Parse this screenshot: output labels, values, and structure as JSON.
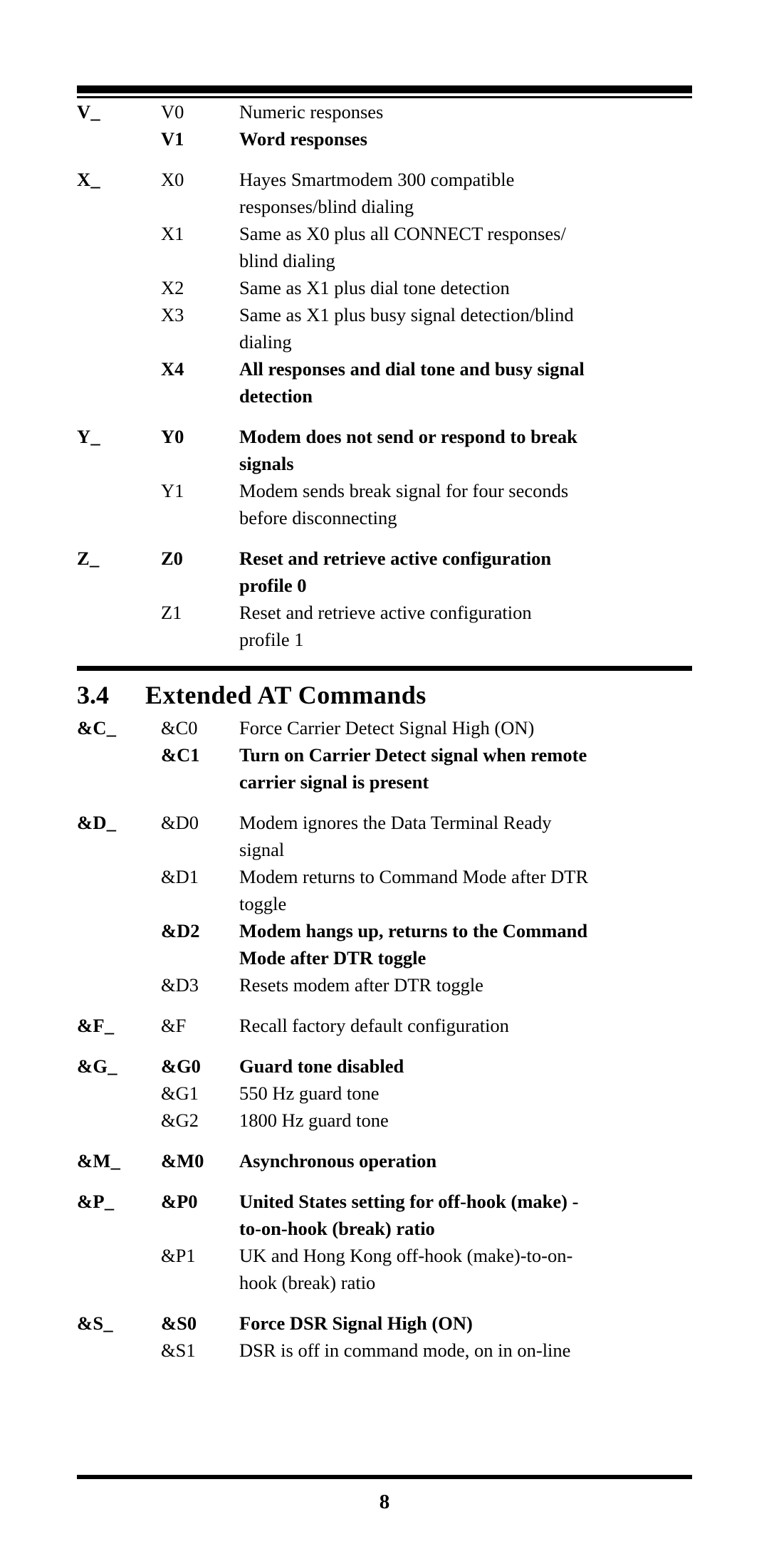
{
  "document": {
    "page_number": "8",
    "section": {
      "number": "3.4",
      "title": "Extended AT Commands"
    }
  },
  "basic_commands": {
    "groups": [
      {
        "group_label": "V_",
        "rows": [
          {
            "variant": "V0",
            "description": "Numeric responses",
            "bold": false
          },
          {
            "variant": "V1",
            "description": "Word responses",
            "bold": true
          }
        ]
      },
      {
        "group_label": "X_",
        "rows": [
          {
            "variant": "X0",
            "description": "Hayes Smartmodem 300 compatible responses/blind dialing",
            "lines": [
              "Hayes Smartmodem 300 compatible",
              "responses/blind dialing"
            ],
            "bold": false
          },
          {
            "variant": "X1",
            "description": "Same as X0 plus all CONNECT responses/ blind dialing",
            "lines": [
              "Same as X0 plus all CONNECT responses/",
              "blind dialing"
            ],
            "bold": false
          },
          {
            "variant": "X2",
            "description": "Same as X1 plus dial tone detection",
            "lines": [
              "Same as X1 plus dial tone detection"
            ],
            "bold": false
          },
          {
            "variant": "X3",
            "description": "Same as X1 plus busy signal detection/blind dialing",
            "lines": [
              "Same as X1 plus busy signal detection/blind",
              "dialing"
            ],
            "bold": false
          },
          {
            "variant": "X4",
            "description": "All responses and dial tone and busy signal detection",
            "lines": [
              "All responses and dial tone and busy signal",
              "detection"
            ],
            "bold": true
          }
        ]
      },
      {
        "group_label": "Y_",
        "rows": [
          {
            "variant": "Y0",
            "description": "Modem does not send or respond to break signals",
            "lines": [
              "Modem does not send or respond to break",
              "signals"
            ],
            "bold": true
          },
          {
            "variant": "Y1",
            "description": "Modem sends break signal for four  seconds before disconnecting",
            "lines": [
              "Modem sends break signal for four  seconds",
              "before disconnecting"
            ],
            "bold": false
          }
        ]
      },
      {
        "group_label": "Z_",
        "rows": [
          {
            "variant": "Z0",
            "description": "Reset and retrieve active configuration profile 0",
            "lines": [
              "Reset and retrieve active configuration",
              "profile 0"
            ],
            "bold": true
          },
          {
            "variant": "Z1",
            "description": "Reset and retrieve active configuration profile 1",
            "lines": [
              "Reset and retrieve active configuration",
              "profile 1"
            ],
            "bold": false
          }
        ]
      }
    ]
  },
  "extended_commands": {
    "groups": [
      {
        "group_label": "&C_",
        "rows": [
          {
            "variant": "&C0",
            "description": "Force Carrier Detect Signal High (ON)",
            "lines": [
              "Force Carrier Detect Signal High (ON)"
            ],
            "bold": false
          },
          {
            "variant": "&C1",
            "description": "Turn on Carrier Detect signal when remote carrier signal is present",
            "lines": [
              "Turn on Carrier Detect signal when remote",
              "carrier signal is present"
            ],
            "bold": true
          }
        ]
      },
      {
        "group_label": "&D_",
        "rows": [
          {
            "variant": "&D0",
            "description": "Modem ignores the Data Terminal Ready signal",
            "lines": [
              "Modem ignores the Data Terminal Ready",
              "signal"
            ],
            "bold": false
          },
          {
            "variant": "&D1",
            "description": "Modem returns to Command Mode after DTR toggle",
            "lines": [
              "Modem returns to Command Mode after DTR",
              "toggle"
            ],
            "bold": false
          },
          {
            "variant": "&D2",
            "description": "Modem hangs up, returns to the Command Mode after  DTR toggle",
            "lines": [
              "Modem hangs up, returns to the Command",
              "Mode after  DTR toggle"
            ],
            "bold": true
          },
          {
            "variant": "&D3",
            "description": "Resets modem after DTR toggle",
            "lines": [
              "Resets modem after DTR toggle"
            ],
            "bold": false
          }
        ]
      },
      {
        "group_label": "&F_",
        "rows": [
          {
            "variant": "&F",
            "description": "Recall factory default configuration",
            "lines": [
              "Recall factory default configuration"
            ],
            "bold": false
          }
        ]
      },
      {
        "group_label": "&G_",
        "rows": [
          {
            "variant": "&G0",
            "description": "Guard tone disabled",
            "lines": [
              "Guard tone disabled"
            ],
            "bold": true
          },
          {
            "variant": "&G1",
            "description": "550 Hz guard tone",
            "lines": [
              "550 Hz guard tone"
            ],
            "bold": false
          },
          {
            "variant": "&G2",
            "description": "1800 Hz guard tone",
            "lines": [
              "1800 Hz guard tone"
            ],
            "bold": false
          }
        ]
      },
      {
        "group_label": "&M_",
        "rows": [
          {
            "variant": "&M0",
            "description": "Asynchronous operation",
            "lines": [
              "Asynchronous operation"
            ],
            "bold": true
          }
        ]
      },
      {
        "group_label": "&P_",
        "rows": [
          {
            "variant": "&P0",
            "description": "United States setting for off-hook (make) -to-on-hook (break) ratio",
            "lines": [
              "United States setting for off-hook (make) -",
              "to-on-hook (break) ratio"
            ],
            "bold": true
          },
          {
            "variant": "&P1",
            "description": "UK and Hong Kong off-hook (make)-to-on-hook (break) ratio",
            "lines": [
              "UK and Hong Kong off-hook (make)-to-on-",
              "hook (break) ratio"
            ],
            "bold": false
          }
        ]
      },
      {
        "group_label": "&S_",
        "rows": [
          {
            "variant": "&S0",
            "description": "Force DSR Signal High (ON)",
            "lines": [
              "Force DSR Signal High (ON)"
            ],
            "bold": true
          },
          {
            "variant": "&S1",
            "description": "DSR is off in command mode, on in on-line",
            "lines": [
              "DSR is off in command mode, on in on-line"
            ],
            "bold": false
          }
        ]
      }
    ]
  }
}
